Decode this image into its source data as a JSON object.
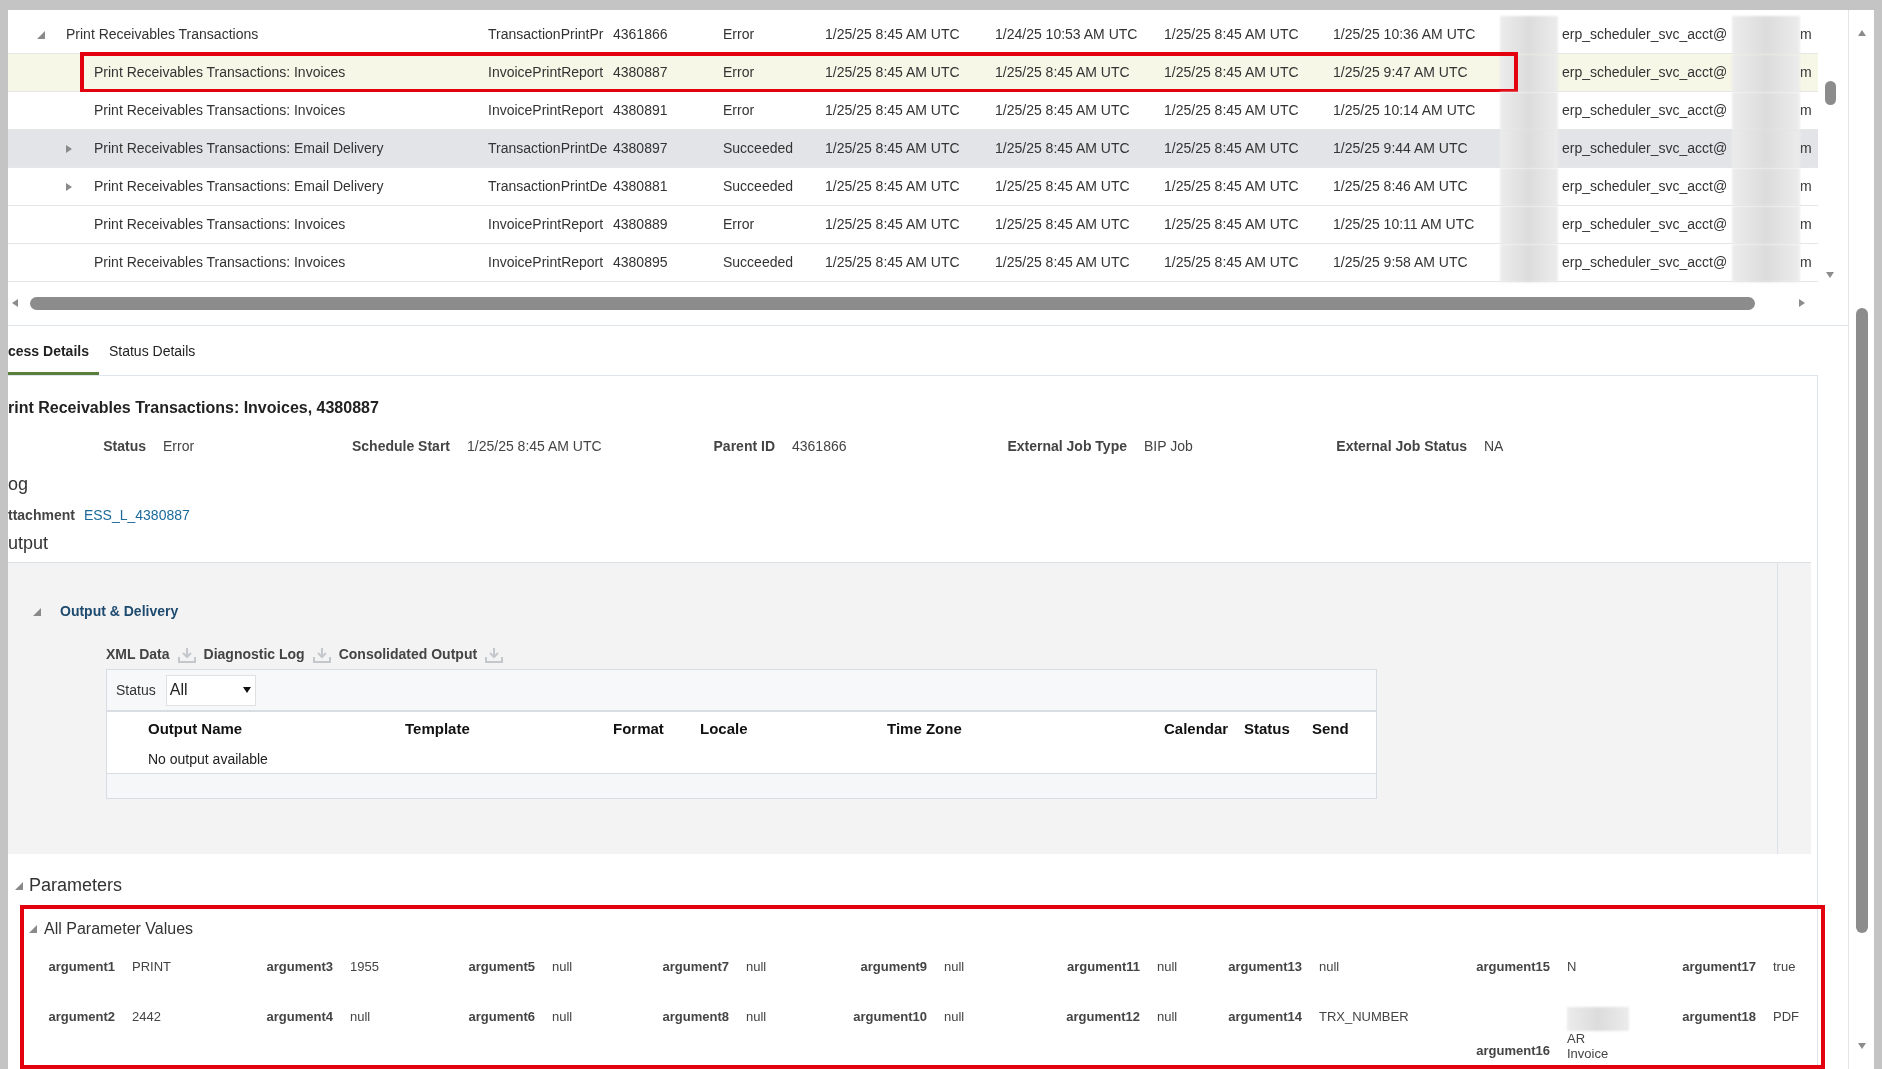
{
  "jobs_table": {
    "rows": [
      {
        "expanded": true,
        "selected": false,
        "hovered": false,
        "annotated": false,
        "cells": [
          "Print Receivables Transactions",
          "TransactionPrintPr",
          "4361866",
          "Error",
          "1/25/25 8:45 AM UTC",
          "1/24/25 10:53 AM UTC",
          "1/25/25 8:45 AM UTC",
          "1/25/25 10:36 AM UTC",
          "erp_scheduler_svc_acct@",
          "m"
        ],
        "children": [
          {
            "selected": true,
            "hovered": false,
            "annotated": true,
            "cells": [
              "Print Receivables Transactions: Invoices",
              "InvoicePrintReport",
              "4380887",
              "Error",
              "1/25/25 8:45 AM UTC",
              "1/25/25 8:45 AM UTC",
              "1/25/25 8:45 AM UTC",
              "1/25/25 9:47 AM UTC",
              "erp_scheduler_svc_acct@",
              "m"
            ]
          },
          {
            "selected": false,
            "hovered": false,
            "annotated": false,
            "cells": [
              "Print Receivables Transactions: Invoices",
              "InvoicePrintReport",
              "4380891",
              "Error",
              "1/25/25 8:45 AM UTC",
              "1/25/25 8:45 AM UTC",
              "1/25/25 8:45 AM UTC",
              "1/25/25 10:14 AM UTC",
              "erp_scheduler_svc_acct@",
              "m"
            ]
          },
          {
            "expanded": false,
            "selected": false,
            "hovered": true,
            "annotated": false,
            "cells": [
              "Print Receivables Transactions: Email Delivery",
              "TransactionPrintDe",
              "4380897",
              "Succeeded",
              "1/25/25 8:45 AM UTC",
              "1/25/25 8:45 AM UTC",
              "1/25/25 8:45 AM UTC",
              "1/25/25 9:44 AM UTC",
              "erp_scheduler_svc_acct@",
              "m"
            ]
          },
          {
            "expanded": false,
            "selected": false,
            "hovered": false,
            "annotated": false,
            "cells": [
              "Print Receivables Transactions: Email Delivery",
              "TransactionPrintDe",
              "4380881",
              "Succeeded",
              "1/25/25 8:45 AM UTC",
              "1/25/25 8:45 AM UTC",
              "1/25/25 8:45 AM UTC",
              "1/25/25 8:46 AM UTC",
              "erp_scheduler_svc_acct@",
              "m"
            ]
          },
          {
            "selected": false,
            "hovered": false,
            "annotated": false,
            "cells": [
              "Print Receivables Transactions: Invoices",
              "InvoicePrintReport",
              "4380889",
              "Error",
              "1/25/25 8:45 AM UTC",
              "1/25/25 8:45 AM UTC",
              "1/25/25 8:45 AM UTC",
              "1/25/25 10:11 AM UTC",
              "erp_scheduler_svc_acct@",
              "m"
            ]
          },
          {
            "selected": false,
            "hovered": false,
            "annotated": false,
            "cells": [
              "Print Receivables Transactions: Invoices",
              "InvoicePrintReport",
              "4380895",
              "Succeeded",
              "1/25/25 8:45 AM UTC",
              "1/25/25 8:45 AM UTC",
              "1/25/25 8:45 AM UTC",
              "1/25/25 9:58 AM UTC",
              "erp_scheduler_svc_acct@",
              "m"
            ]
          }
        ]
      }
    ]
  },
  "tabs": [
    {
      "label": "cess Details",
      "selected": true
    },
    {
      "label": "Status Details",
      "selected": false
    }
  ],
  "details": {
    "title": "rint Receivables Transactions: Invoices, 4380887",
    "fields": [
      {
        "label": "Status",
        "value": "Error"
      },
      {
        "label": "Schedule Start",
        "value": "1/25/25 8:45 AM UTC"
      },
      {
        "label": "Parent ID",
        "value": "4361866"
      },
      {
        "label": "External Job Type",
        "value": "BIP Job"
      },
      {
        "label": "External Job Status",
        "value": "NA"
      }
    ],
    "log_heading": "og",
    "attachment_label": "ttachment",
    "attachment_link": "ESS_L_4380887",
    "output_heading": "utput"
  },
  "output": {
    "title": "Output & Delivery",
    "expanded": true,
    "downloads": [
      "XML Data",
      "Diagnostic Log",
      "Consolidated Output"
    ],
    "filter": {
      "label": "Status",
      "value": "All"
    },
    "columns": [
      "Output Name",
      "Template",
      "Format",
      "Locale",
      "Time Zone",
      "Calendar",
      "Status",
      "Send"
    ],
    "empty_message": "No output available"
  },
  "parameters": {
    "title": "Parameters",
    "expanded": true,
    "annotated": true,
    "group": {
      "title": "All Parameter Values",
      "expanded": true,
      "arguments": [
        {
          "label": "argument1",
          "value": "PRINT",
          "redacted": false
        },
        {
          "label": "argument3",
          "value": "1955",
          "redacted": false
        },
        {
          "label": "argument5",
          "value": "null",
          "redacted": false
        },
        {
          "label": "argument7",
          "value": "null",
          "redacted": false
        },
        {
          "label": "argument9",
          "value": "null",
          "redacted": false
        },
        {
          "label": "argument11",
          "value": "null",
          "redacted": false
        },
        {
          "label": "argument13",
          "value": "null",
          "redacted": false
        },
        {
          "label": "argument15",
          "value": "N",
          "redacted": false
        },
        {
          "label": "argument17",
          "value": "true",
          "redacted": false
        },
        {
          "label": "argument2",
          "value": "2442",
          "redacted": false
        },
        {
          "label": "argument4",
          "value": "null",
          "redacted": false
        },
        {
          "label": "argument6",
          "value": "null",
          "redacted": false
        },
        {
          "label": "argument8",
          "value": "null",
          "redacted": false
        },
        {
          "label": "argument10",
          "value": "null",
          "redacted": false
        },
        {
          "label": "argument12",
          "value": "null",
          "redacted": false
        },
        {
          "label": "argument14",
          "value": "TRX_NUMBER",
          "redacted": false
        },
        {
          "label": "argument16",
          "value": "AR Invoice",
          "redacted": true
        },
        {
          "label": "argument18",
          "value": "PDF",
          "redacted": false
        }
      ]
    }
  }
}
